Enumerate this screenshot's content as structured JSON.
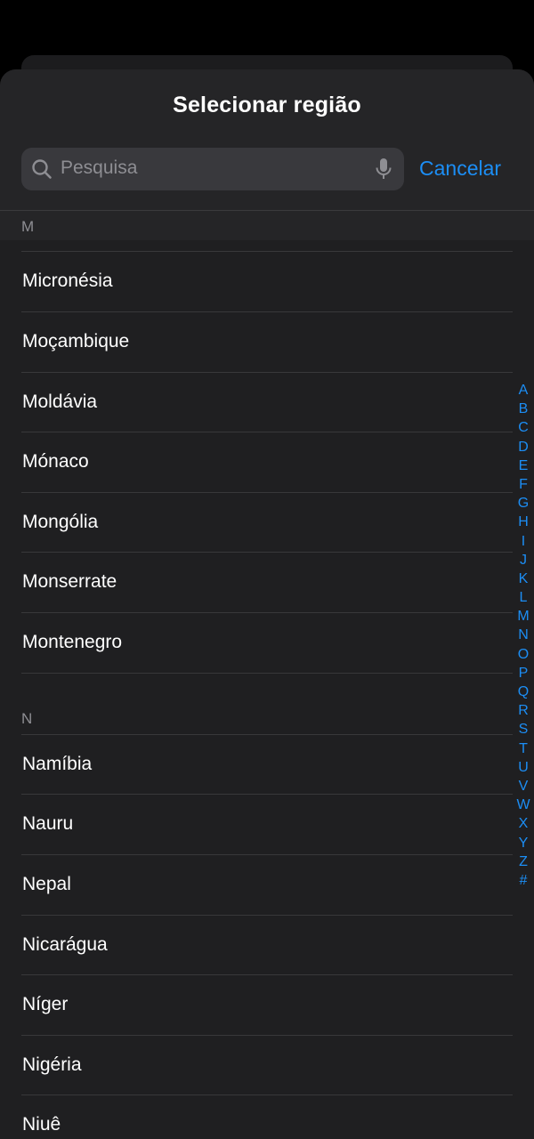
{
  "header": {
    "title": "Selecionar região",
    "search_placeholder": "Pesquisa",
    "cancel_label": "Cancelar"
  },
  "sections": [
    {
      "letter": "M",
      "items": [
        "Micronésia",
        "Moçambique",
        "Moldávia",
        "Mónaco",
        "Mongólia",
        "Monserrate",
        "Montenegro"
      ]
    },
    {
      "letter": "N",
      "items": [
        "Namíbia",
        "Nauru",
        "Nepal",
        "Nicarágua",
        "Níger",
        "Nigéria",
        "Niuê"
      ]
    }
  ],
  "index": [
    "A",
    "B",
    "C",
    "D",
    "E",
    "F",
    "G",
    "H",
    "I",
    "J",
    "K",
    "L",
    "M",
    "N",
    "O",
    "P",
    "Q",
    "R",
    "S",
    "T",
    "U",
    "V",
    "W",
    "X",
    "Y",
    "Z",
    "#"
  ],
  "icons": {
    "search": "magnifying-glass",
    "mic": "microphone"
  },
  "colors": {
    "accent": "#1c8ef5",
    "background": "#1f1f21",
    "secondary_text": "#8e8e93"
  }
}
